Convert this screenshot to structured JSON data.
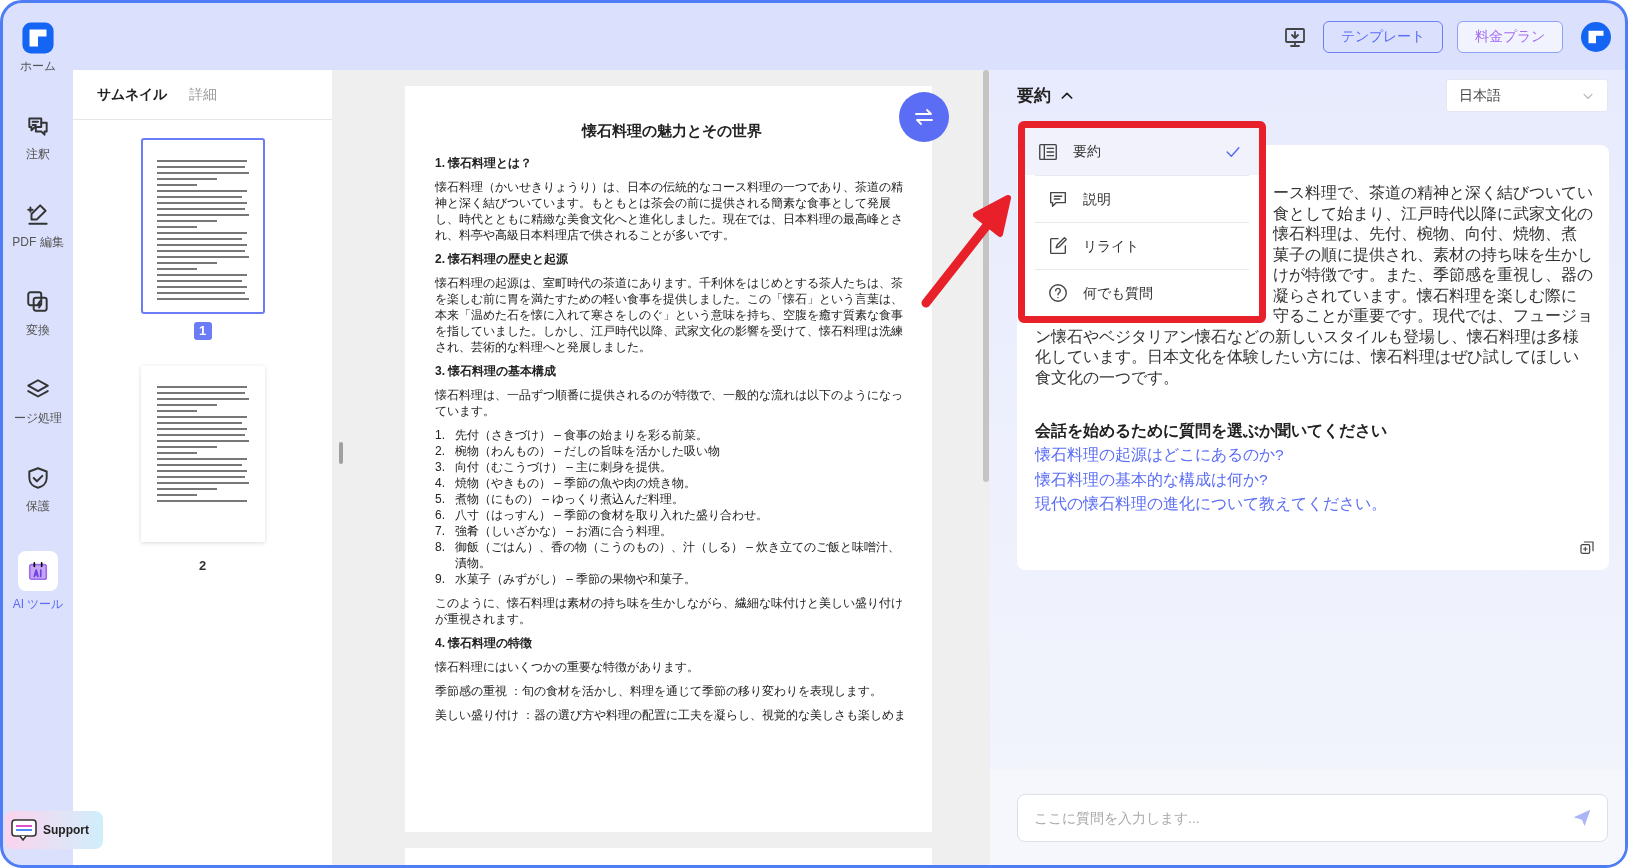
{
  "rail": {
    "items": [
      {
        "label": "ホーム",
        "selected": false
      },
      {
        "label": "注釈",
        "selected": false
      },
      {
        "label": "PDF 編集",
        "selected": false
      },
      {
        "label": "変換",
        "selected": false
      },
      {
        "label": "ージ処理",
        "selected": false
      },
      {
        "label": "保護",
        "selected": false
      },
      {
        "label": "AI ツール",
        "selected": true
      }
    ]
  },
  "topbar": {
    "buttons": [
      {
        "label": "テンプレート"
      },
      {
        "label": "料金プラン"
      }
    ]
  },
  "thumbnail_panel": {
    "tabs": [
      {
        "label": "サムネイル",
        "selected": true
      },
      {
        "label": "詳細",
        "selected": false
      }
    ],
    "pages": [
      {
        "label": "1",
        "selected": true
      },
      {
        "label": "2",
        "selected": false
      }
    ]
  },
  "document": {
    "title": "懐石料理の魅力とその世界",
    "blocks": [
      {
        "kind": "heading",
        "text": "1.  懐石料理とは？"
      },
      {
        "kind": "paragraph",
        "text": "懐石料理（かいせきりょうり）は、日本の伝統的なコース料理の一つであり、茶道の精神と深く結びついています。もともとは茶会の前に提供される簡素な食事として発展し、時代とともに精緻な美食文化へと進化しました。現在では、日本料理の最高峰とされ、料亭や高級日本料理店で供されることが多いです。"
      },
      {
        "kind": "heading",
        "text": "2.  懐石料理の歴史と起源"
      },
      {
        "kind": "paragraph",
        "text": "懐石料理の起源は、室町時代の茶道にあります。千利休をはじめとする茶人たちは、茶を楽しむ前に胃を満たすための軽い食事を提供しました。この「懐石」という言葉は、本来「温めた石を懐に入れて寒さをしのぐ」という意味を持ち、空腹を癒す質素な食事を指していました。しかし、江戸時代以降、武家文化の影響を受けて、懐石料理は洗練され、芸術的な料理へと発展しました。"
      },
      {
        "kind": "heading",
        "text": "3.  懐石料理の基本構成"
      },
      {
        "kind": "paragraph",
        "text": "懐石料理は、一品ずつ順番に提供されるのが特徴で、一般的な流れは以下のようになっています。"
      },
      {
        "kind": "list",
        "items": [
          {
            "number": "1.",
            "text": "先付（さきづけ） – 食事の始まりを彩る前菜。"
          },
          {
            "number": "2.",
            "text": "椀物（わんもの） – だしの旨味を活かした吸い物"
          },
          {
            "number": "3.",
            "text": "向付（むこうづけ） – 主に刺身を提供。"
          },
          {
            "number": "4.",
            "text": "焼物（やきもの） – 季節の魚や肉の焼き物。"
          },
          {
            "number": "5.",
            "text": "煮物（にもの） – ゆっくり煮込んだ料理。"
          },
          {
            "number": "6.",
            "text": "八寸（はっすん） – 季節の食材を取り入れた盛り合わせ。"
          },
          {
            "number": "7.",
            "text": "強肴（しいざかな） – お酒に合う料理。"
          },
          {
            "number": "8.",
            "text": "御飯（ごはん）、香の物（こうのもの）、汁（しる） – 炊き立てのご飯と味噌汁、漬物。"
          },
          {
            "number": "9.",
            "text": "水菓子（みずがし） – 季節の果物や和菓子。"
          }
        ]
      },
      {
        "kind": "paragraph",
        "text": "このように、懐石料理は素材の持ち味を生かしながら、繊細な味付けと美しい盛り付けが重視されます。"
      },
      {
        "kind": "heading",
        "text": "4.  懐石料理の特徴"
      },
      {
        "kind": "paragraph",
        "text": "懐石料理にはいくつかの重要な特徴があります。"
      },
      {
        "kind": "paragraph",
        "text": "季節感の重視 ：旬の食材を活かし、料理を通じて季節の移り変わりを表現します。"
      },
      {
        "kind": "paragraph",
        "text": "美しい盛り付け ：器の選び方や料理の配置に工夫を凝らし、視覚的な美しさも楽しめま"
      }
    ]
  },
  "ai_panel": {
    "mode": "要約",
    "expanded": true,
    "language": "日本語",
    "menu": [
      {
        "label": "要約",
        "selected": true
      },
      {
        "label": "説明",
        "selected": false
      },
      {
        "label": "リライト",
        "selected": false
      },
      {
        "label": "何でも質問",
        "selected": false
      }
    ],
    "summary_lines_beside_menu": [
      "ース料理で、茶道の精神と深く結びついてい",
      "食として始まり、江戸時代以降に武家文化の",
      "懐石料理は、先付、椀物、向付、焼物、煮",
      "菓子の順に提供され、素材の持ち味を生かし",
      "けが特徴です。また、季節感を重視し、器の",
      "凝らされています。懐石料理を楽しむ際に",
      "守ることが重要です。現代では、フュージョ"
    ],
    "summary_lines": [
      "ン懐石やベジタリアン懐石などの新しいスタイルも登場し、懐石料理は多様",
      "化しています。日本文化を体験したい方には、懐石料理はぜひ試してほしい",
      "食文化の一つです。"
    ],
    "prompt_heading": "会話を始めるために質問を選ぶか聞いてください",
    "suggestions": [
      "懐石料理の起源はどこにあるのか?",
      "懐石料理の基本的な構成は何か?",
      "現代の懐石料理の進化について教えてください。"
    ],
    "input": {
      "placeholder": "ここに質問を入力します..."
    }
  },
  "support": {
    "label": "Support"
  }
}
